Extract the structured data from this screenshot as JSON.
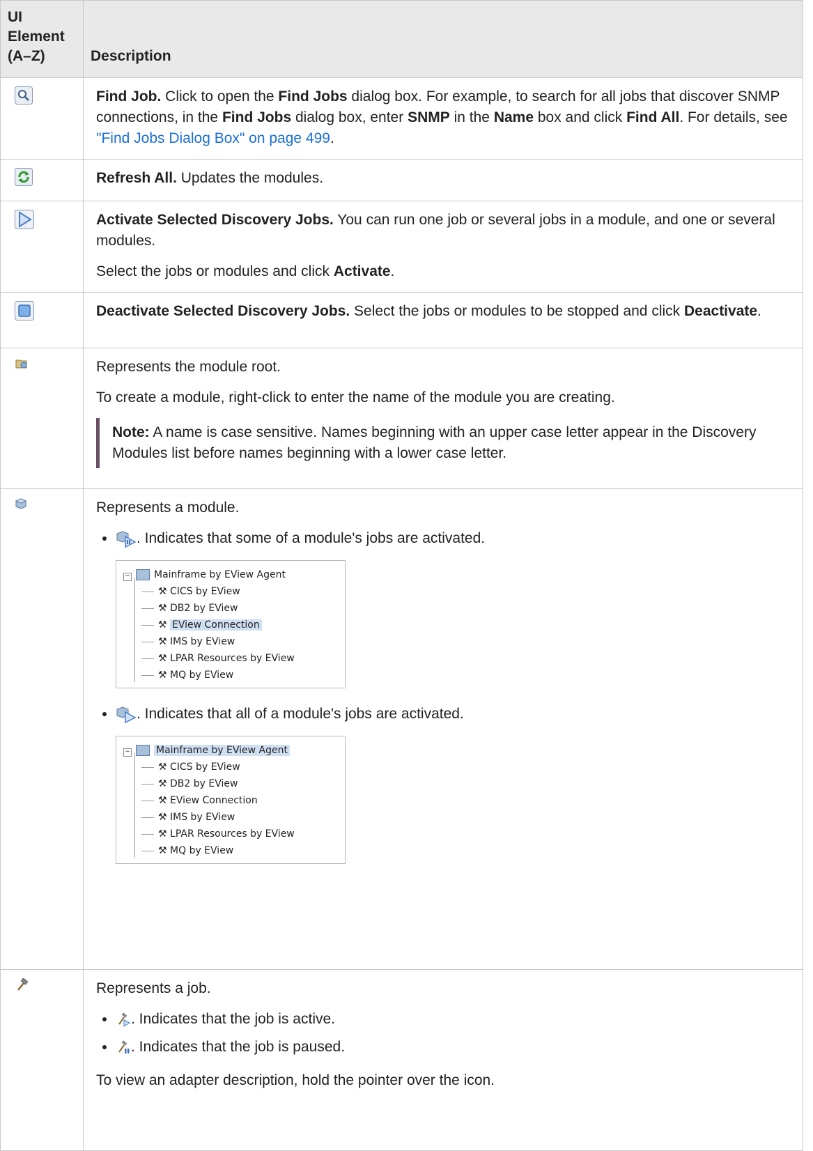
{
  "header": {
    "col1_line1": "UI",
    "col1_line2": "Element",
    "col1_line3": "(A–Z)",
    "col2": "Description"
  },
  "rows": {
    "find": {
      "icon": "magnifier-icon",
      "title": "Find Job.",
      "t1": " Click to open the ",
      "b1": "Find Jobs",
      "t2": " dialog box. For example, to search for all jobs that discover SNMP connections, in the ",
      "b2": "Find Jobs",
      "t3": " dialog box, enter ",
      "b3": "SNMP",
      "t4": " in the ",
      "b4": "Name",
      "t5": " box and click ",
      "b5": "Find All",
      "t6": ". For details, see ",
      "link": "\"Find Jobs Dialog Box\" on page 499",
      "t7": "."
    },
    "refresh": {
      "icon": "refresh-icon",
      "title": "Refresh All.",
      "text": " Updates the modules."
    },
    "activate": {
      "icon": "play-icon",
      "title": "Activate Selected Discovery Jobs.",
      "text": " You can run one job or several jobs in a module, and one or several modules.",
      "p2a": "Select the jobs or modules and click ",
      "p2b": "Activate",
      "p2c": "."
    },
    "deactivate": {
      "icon": "stop-icon",
      "title": "Deactivate Selected Discovery Jobs.",
      "text": " Select the jobs or modules to be stopped and click ",
      "b1": "Deactivate",
      "t2": "."
    },
    "root": {
      "icon": "module-root-icon",
      "p1": "Represents the module root.",
      "p2": "To create a module, right-click to enter the name of the module you are creating.",
      "note_label": "Note:",
      "note_text": "  A name is case sensitive. Names beginning with an upper case letter appear in the Discovery Modules list before names beginning with a lower case letter."
    },
    "module": {
      "icon": "module-icon",
      "p1": "Represents a module.",
      "b1": ". Indicates that some of a module's jobs are activated.",
      "b2": ". Indicates that all of a module's jobs are activated.",
      "tree1": {
        "root": "Mainframe by EView Agent",
        "items": [
          "CICS by EView",
          "DB2 by EView",
          "EView Connection",
          "IMS by EView",
          "LPAR Resources by EView",
          "MQ by EView"
        ]
      },
      "tree2": {
        "root": "Mainframe by EView Agent",
        "items": [
          "CICS by EView",
          "DB2 by EView",
          "EView Connection",
          "IMS by EView",
          "LPAR Resources by EView",
          "MQ by EView"
        ]
      }
    },
    "job": {
      "icon": "hammer-icon",
      "p1": "Represents a job.",
      "b1": ". Indicates that the job is active.",
      "b2": ". Indicates that the job is paused.",
      "p2": "To view an adapter description, hold the pointer over the icon."
    }
  }
}
